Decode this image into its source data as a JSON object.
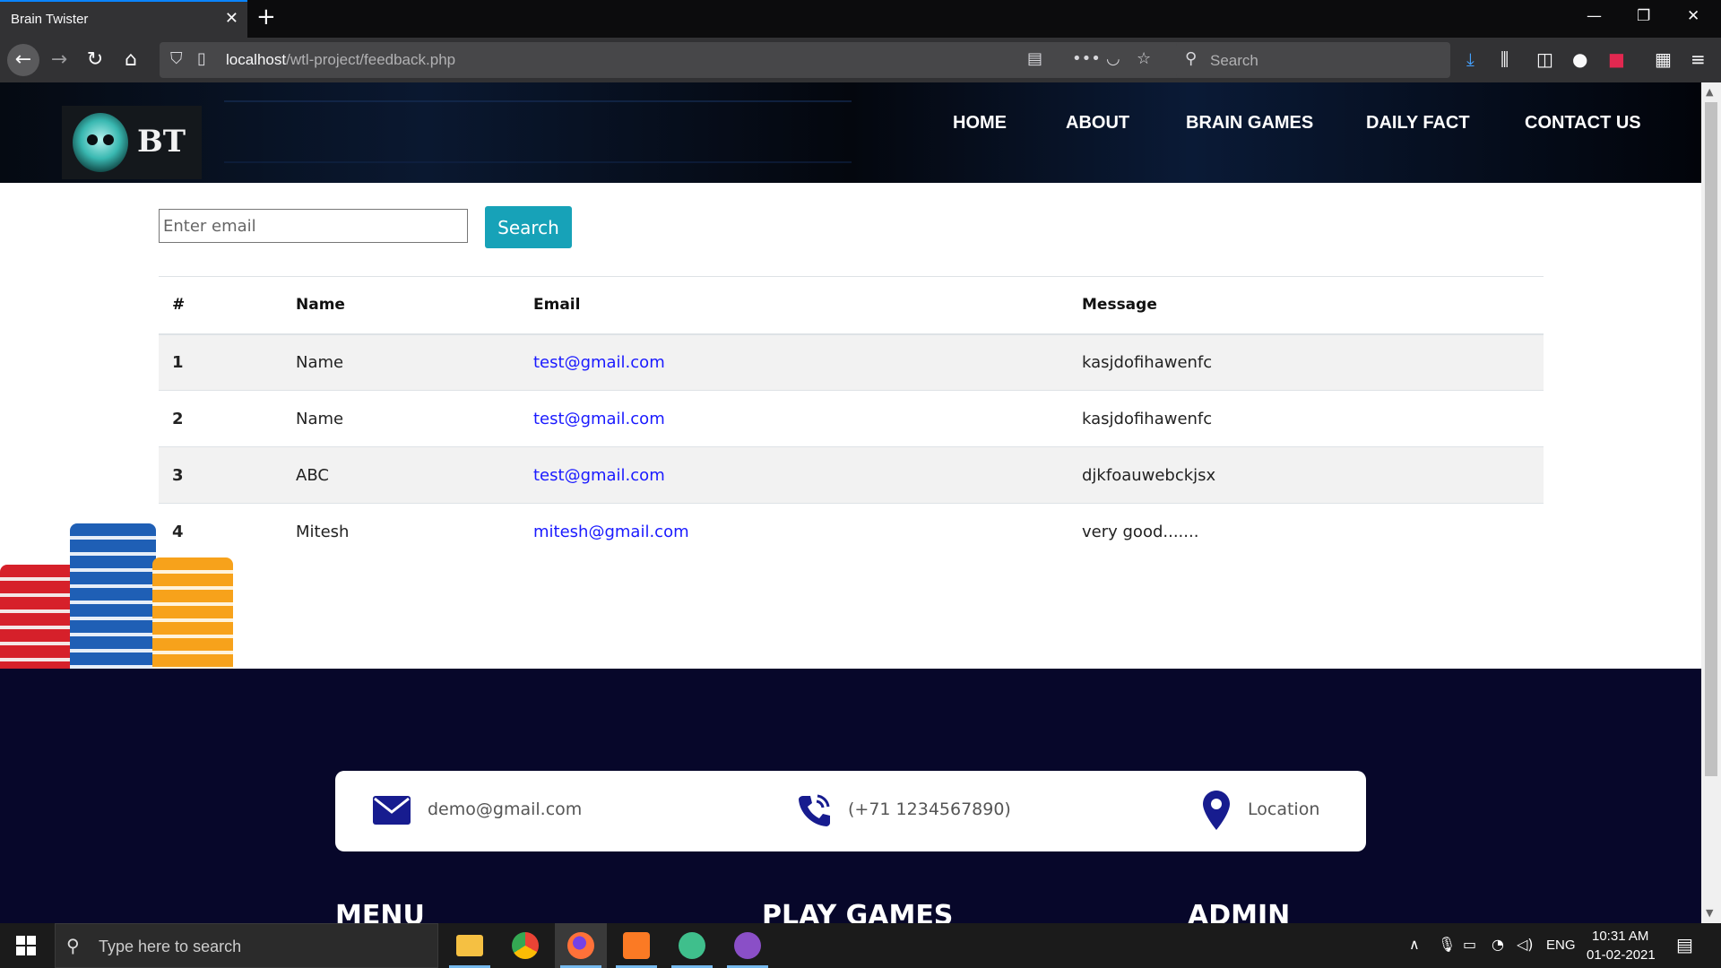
{
  "browser": {
    "tab_title": "Brain Twister",
    "tab_close": "✕",
    "new_tab": "+",
    "url_host": "localhost",
    "url_path": "/wtl-project/feedback.php",
    "search_placeholder": "Search"
  },
  "site": {
    "logo_text": "BT",
    "menu": [
      "HOME",
      "ABOUT",
      "BRAIN GAMES",
      "DAILY FACT",
      "CONTACT US"
    ]
  },
  "search_form": {
    "placeholder": "Enter email",
    "button_label": "Search"
  },
  "table": {
    "headers": [
      "#",
      "Name",
      "Email",
      "Message"
    ],
    "rows": [
      {
        "num": "1",
        "name": "Name",
        "email": "test@gmail.com",
        "message": "kasjdofihawenfc"
      },
      {
        "num": "2",
        "name": "Name",
        "email": "test@gmail.com",
        "message": "kasjdofihawenfc"
      },
      {
        "num": "3",
        "name": "ABC",
        "email": "test@gmail.com",
        "message": "djkfoauwebckjsx"
      },
      {
        "num": "4",
        "name": "Mitesh",
        "email": "mitesh@gmail.com",
        "message": "very good......."
      }
    ]
  },
  "footer": {
    "contact_email": "demo@gmail.com",
    "contact_phone": "(+71 1234567890)",
    "contact_location": "Location",
    "headings": [
      "MENU",
      "PLAY GAMES",
      "ADMIN"
    ]
  },
  "taskbar": {
    "search_placeholder": "Type here to search",
    "language": "ENG",
    "time": "10:31 AM",
    "date": "01-02-2021"
  },
  "colors": {
    "accent_button": "#17a2b8",
    "footer_bg": "#07072a",
    "link_color": "#1a1aff",
    "contact_icon": "#171c8f"
  },
  "icons": {
    "contact": [
      "envelope-icon",
      "phone-icon",
      "map-pin-icon"
    ]
  }
}
